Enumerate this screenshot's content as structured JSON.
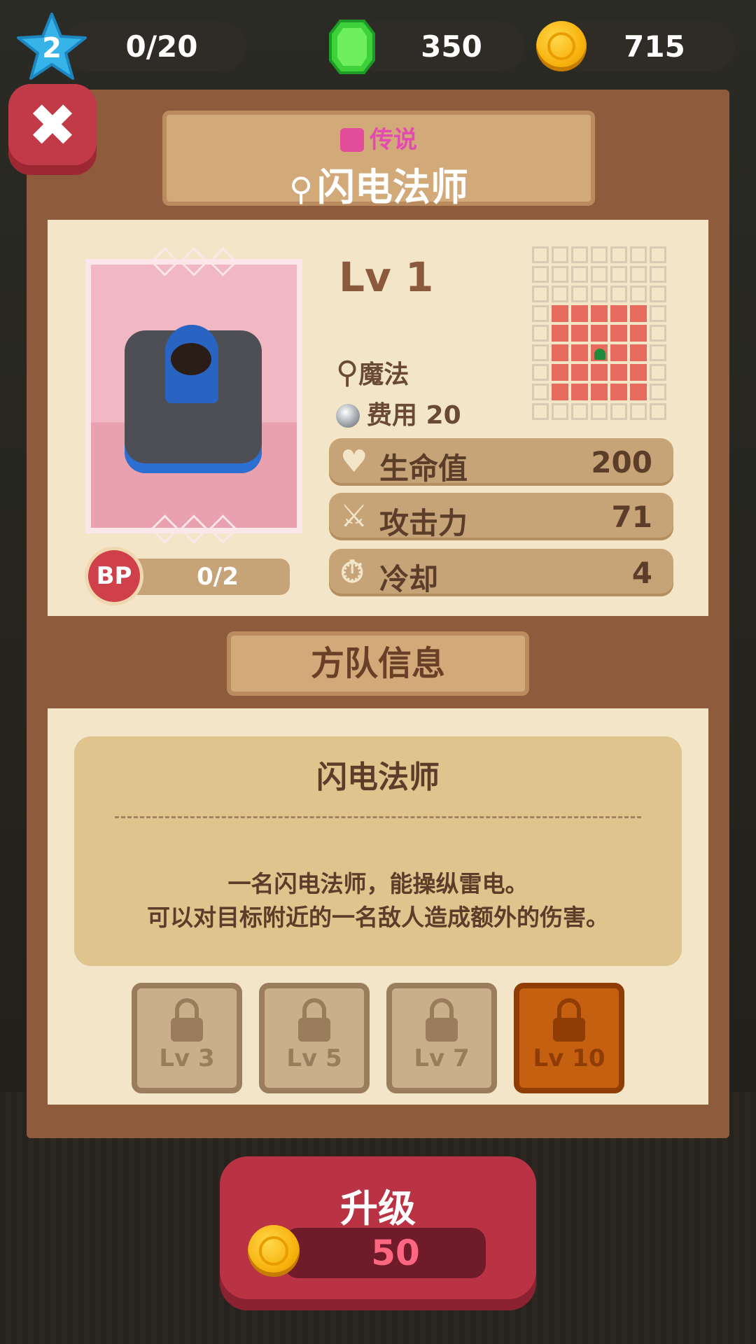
{
  "topbar": {
    "level": "2",
    "exp": "0/20",
    "gems": "350",
    "coins": "715"
  },
  "header": {
    "rarity": "传说",
    "unit_name": "闪电法师"
  },
  "card": {
    "level": "Lv 1",
    "type": "魔法",
    "cost": "费用 20",
    "bp_label": "BP",
    "bp_value": "0/2",
    "stats": [
      {
        "label": "生命值",
        "value": "200",
        "icon": "heart-icon"
      },
      {
        "label": "攻击力",
        "value": "71",
        "icon": "sword-icon"
      },
      {
        "label": "冷却",
        "value": "4",
        "icon": "timer-icon"
      }
    ]
  },
  "section_title": "方队信息",
  "description": {
    "title": "闪电法师",
    "line1": "一名闪电法师，能操纵雷电。",
    "line2": "可以对目标附近的一名敌人造成额外的伤害。"
  },
  "skills": [
    {
      "level": "Lv 3"
    },
    {
      "level": "Lv 5"
    },
    {
      "level": "Lv 7"
    },
    {
      "level": "Lv 10"
    }
  ],
  "upgrade": {
    "label": "升级",
    "price": "50"
  },
  "colors": {
    "frame": "#8f5b3d",
    "accent_red": "#c23a47",
    "rarity_pink": "#e34bb2",
    "range_red": "#e76b5e"
  }
}
